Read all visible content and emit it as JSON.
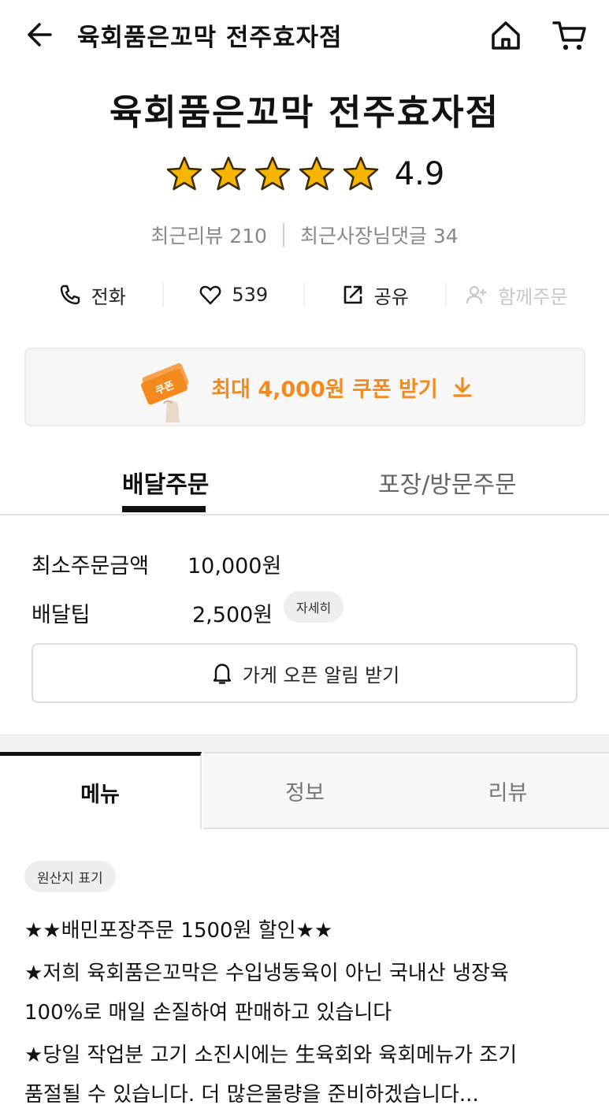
{
  "header": {
    "title": "육회품은꼬막 전주효자점"
  },
  "store": {
    "name": "육회품은꼬막 전주효자점",
    "rating": "4.9",
    "star_count": 5,
    "recent_reviews": "최근리뷰 210",
    "owner_replies": "최근사장님댓글 34"
  },
  "actions": {
    "call": "전화",
    "likes": "539",
    "share": "공유",
    "group_order": "함께주문"
  },
  "coupon": {
    "badge": "쿠폰",
    "text": "최대 4,000원 쿠폰 받기"
  },
  "order_tabs": {
    "delivery": "배달주문",
    "pickup": "포장/방문주문"
  },
  "order_info": {
    "min_order_label": "최소주문금액",
    "min_order_value": "10,000원",
    "delivery_tip_label": "배달팁",
    "delivery_tip_value": "2,500원",
    "detail_label": "자세히"
  },
  "open_alert": {
    "label": "가게 오픈 알림 받기"
  },
  "menu_tabs": {
    "menu": "메뉴",
    "info": "정보",
    "reviews": "리뷰"
  },
  "origin": {
    "label": "원산지 표기"
  },
  "notice": {
    "line1": "★★배민포장주문 1500원 할인★★",
    "line2": "★저희 육회품은꼬막은 수입냉동육이 아닌 국내산 냉장육",
    "line3": "100%로 매일 손질하여 판매하고 있습니다",
    "line4": "★당일 작업분 고기 소진시에는 生육회와 육회메뉴가 조기",
    "line5": "품절될 수 있습니다. 더 많은물량을 준비하겠습니다..."
  },
  "colors": {
    "accent": "#f48a1e",
    "star": "#f7b500",
    "text": "#111111",
    "muted": "#888888"
  }
}
